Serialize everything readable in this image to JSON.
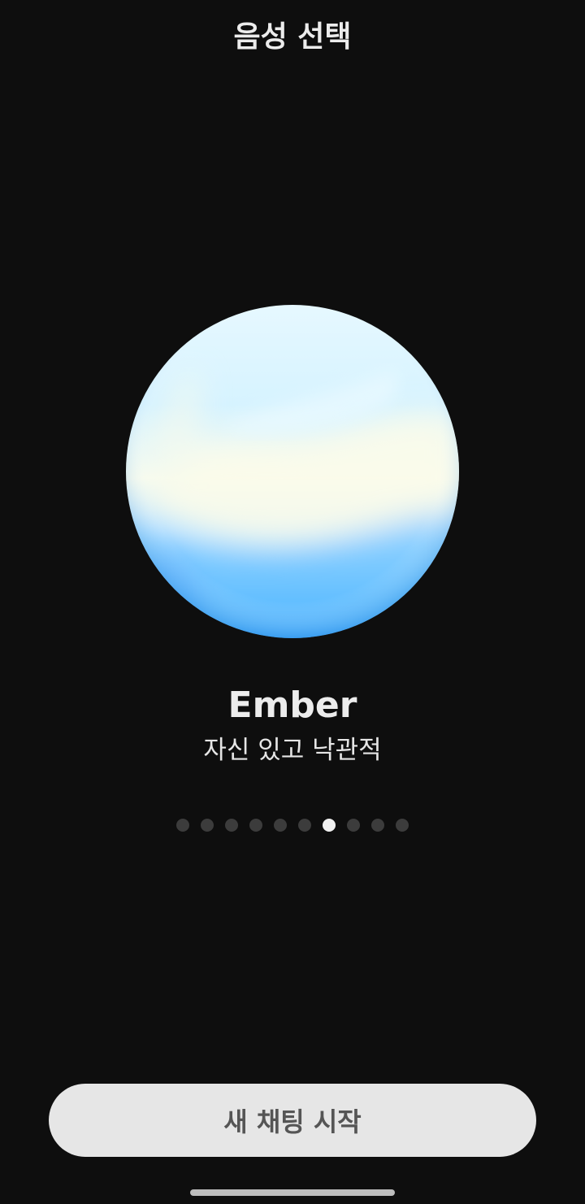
{
  "header": {
    "title": "음성 선택"
  },
  "voice": {
    "name": "Ember",
    "description": "자신 있고 낙관적",
    "orb_colors": [
      "#e6f8ff",
      "#f6fbef",
      "#5cbcff",
      "#3aa6ff"
    ]
  },
  "carousel": {
    "total": 10,
    "current": 7
  },
  "actions": {
    "start_label": "새 채팅 시작"
  },
  "colors": {
    "background": "#0e0e0e",
    "button_bg": "#e6e6e6",
    "button_text": "#555555",
    "dot_active": "#f1f1f1",
    "dot_inactive": "#3c3c3c"
  }
}
